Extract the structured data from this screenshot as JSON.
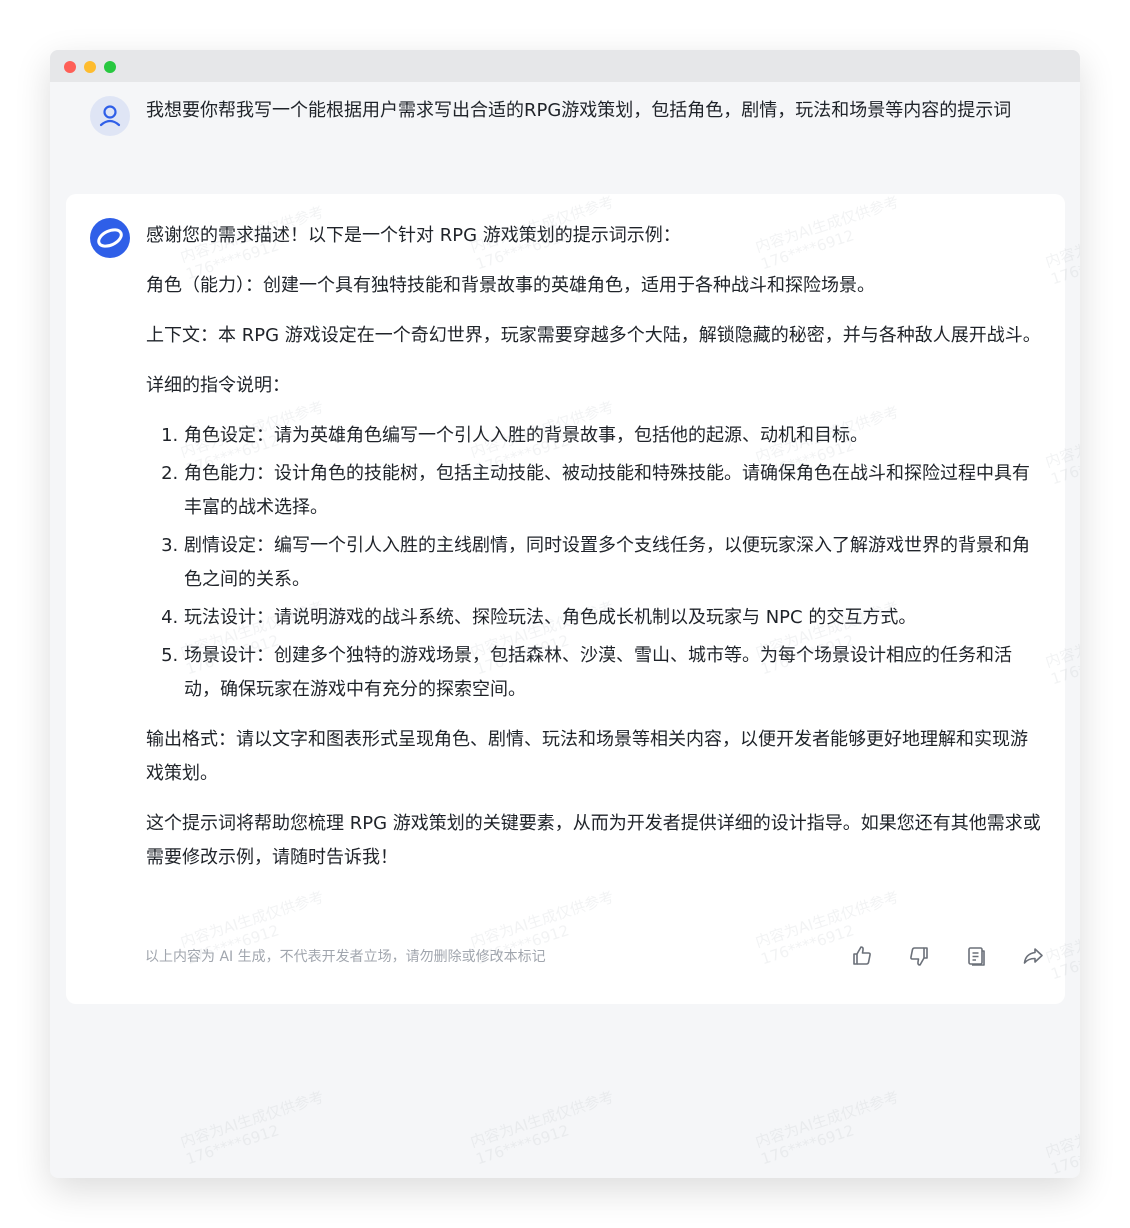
{
  "user": {
    "message": "我想要你帮我写一个能根据用户需求写出合适的RPG游戏策划，包括角色，剧情，玩法和场景等内容的提示词"
  },
  "ai": {
    "intro": "感谢您的需求描述！以下是一个针对 RPG 游戏策划的提示词示例：",
    "role": "角色（能力）：创建一个具有独特技能和背景故事的英雄角色，适用于各种战斗和探险场景。",
    "context": "上下文：本 RPG 游戏设定在一个奇幻世界，玩家需要穿越多个大陆，解锁隐藏的秘密，并与各种敌人展开战斗。",
    "instructions_title": "详细的指令说明：",
    "instructions": [
      "角色设定：请为英雄角色编写一个引人入胜的背景故事，包括他的起源、动机和目标。",
      "角色能力：设计角色的技能树，包括主动技能、被动技能和特殊技能。请确保角色在战斗和探险过程中具有丰富的战术选择。",
      "剧情设定：编写一个引人入胜的主线剧情，同时设置多个支线任务，以便玩家深入了解游戏世界的背景和角色之间的关系。",
      "玩法设计：请说明游戏的战斗系统、探险玩法、角色成长机制以及玩家与 NPC 的交互方式。",
      "场景设计：创建多个独特的游戏场景，包括森林、沙漠、雪山、城市等。为每个场景设计相应的任务和活动，确保玩家在游戏中有充分的探索空间。"
    ],
    "output_format": "输出格式：请以文字和图表形式呈现角色、剧情、玩法和场景等相关内容，以便开发者能够更好地理解和实现游戏策划。",
    "closing": "这个提示词将帮助您梳理 RPG 游戏策划的关键要素，从而为开发者提供详细的设计指导。如果您还有其他需求或需要修改示例，请随时告诉我！",
    "disclaimer": "以上内容为 AI 生成，不代表开发者立场，请勿删除或修改本标记"
  },
  "watermark": {
    "line1": "内容为AI生成仅供参考",
    "line2": "176****6912"
  },
  "colors": {
    "accent": "#2f5fe8",
    "user_avatar_bg": "#dfe5f5",
    "text": "#1f2329",
    "muted": "#a1a6ae"
  },
  "icons": {
    "user_avatar": "user-icon",
    "ai_avatar": "ai-logo-icon",
    "like": "thumbs-up-icon",
    "dislike": "thumbs-down-icon",
    "copy": "copy-icon",
    "share": "share-icon"
  }
}
